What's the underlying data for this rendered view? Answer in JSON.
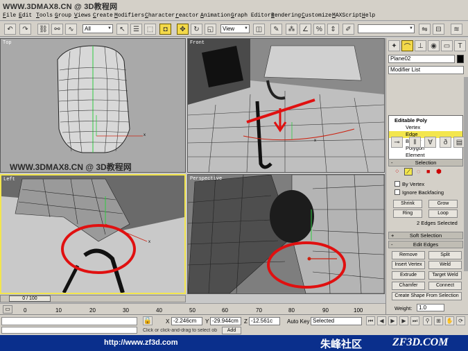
{
  "watermark": {
    "top": "WWW.3DMAX8.CN @ 3D教程网",
    "mid": "WWW.3DMAX8.CN @ 3D教程网"
  },
  "menu": [
    "File",
    "Edit",
    "Tools",
    "Group",
    "Views",
    "Create",
    "Modifiers",
    "Character",
    "reactor",
    "Animation",
    "Graph Editors",
    "Rendering",
    "Customize",
    "MAXScript",
    "Help"
  ],
  "toolbar": {
    "filter_value": "All",
    "view_value": "View",
    "named_selection": ""
  },
  "viewports": {
    "top": "Top",
    "front": "Front",
    "left": "Left",
    "perspective": "Perspective"
  },
  "command_panel": {
    "object_name": "Plane02",
    "modifier_list": "Modifier List",
    "stack": [
      {
        "label": "Editable Poly",
        "head": true
      },
      {
        "label": "Vertex"
      },
      {
        "label": "Edge",
        "selected": true
      },
      {
        "label": "Border"
      },
      {
        "label": "Polygon"
      },
      {
        "label": "Element"
      }
    ],
    "rollouts": {
      "selection": "Selection",
      "soft_selection": "Soft Selection",
      "edit_edges": "Edit Edges"
    },
    "checkboxes": {
      "by_vertex": "By Vertex",
      "ignore_backfacing": "Ignore Backfacing"
    },
    "buttons": {
      "shrink": "Shrink",
      "grow": "Grow",
      "ring": "Ring",
      "loop": "Loop",
      "remove": "Remove",
      "split": "Split",
      "insert_vertex": "Insert Vertex",
      "weld": "Weld",
      "extrude": "Extrude",
      "target_weld": "Target Weld",
      "chamfer": "Chamfer",
      "connect": "Connect",
      "create_shape": "Create Shape From Selection"
    },
    "selection_status": "2 Edges Selected",
    "weight_label": "Weight:",
    "weight_value": "1.0"
  },
  "timeline": {
    "slider": "0 / 100",
    "ticks": [
      "0",
      "10",
      "20",
      "30",
      "40",
      "50",
      "60",
      "70",
      "80",
      "90",
      "100"
    ]
  },
  "status": {
    "x_label": "X",
    "x_value": "-2.246cm",
    "y_label": "Y",
    "y_value": "-29.944cm",
    "z_label": "Z",
    "z_value": "-12.561c",
    "autokey": "Auto Key",
    "key_filter": "Selected",
    "prompt": "Click or click-and-drag to select ob",
    "add_time_tag": "Add"
  },
  "footer": {
    "url": "http://www.zf3d.com",
    "brand": "朱峰社区",
    "brand_en": "ZF3D.COM"
  },
  "colors": {
    "accent": "#f3e64d",
    "annotation": "#e01010",
    "footer_bg": "#0a2f8c"
  }
}
